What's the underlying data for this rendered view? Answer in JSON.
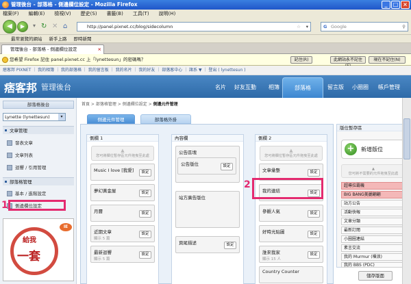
{
  "window": {
    "title": "管理後台 - 部落格 - 側邊欄位設定 - Mozilla Firefox"
  },
  "menu": [
    "檔案(F)",
    "編輯(E)",
    "檢視(V)",
    "歷史(S)",
    "書籤(B)",
    "工具(T)",
    "說明(H)"
  ],
  "nav": {
    "url": "http://panel.pixnet.cc/blog/sidecolumn",
    "search_placeholder": "Google"
  },
  "bookmarks": [
    "最常瀏覽的網站",
    "新手上路",
    "即時新聞"
  ],
  "tab": {
    "title": "管理後台 - 部落格 - 側邊欄位設定"
  },
  "notification": {
    "text": "您希望 Firefox 記住 panel.pixnet.cc 上「lynettesun」的密碼嗎？",
    "remember": "記住(R)",
    "never": "此網站永不記住(E)",
    "not_now": "現在不記住(N)"
  },
  "usernav": "痞客邦 PIXNET ｜ 我的相簿 ｜ 我的部落格 ｜ 我的留言板 ｜ 我的名片 ｜ 我的好友 ｜ 部落客中心 ｜ 諸系 ▼ ｜ 登出 ( lynettesun )",
  "header": {
    "logo": "痞客邦",
    "subtitle": "管理後台",
    "items": [
      "名片",
      "好友互動",
      "相簿",
      "部落格",
      "留言版",
      "小圈圈",
      "帳戶管理"
    ]
  },
  "sidebar": {
    "head": "部落格後台",
    "select": "Lynette (lynettesun)",
    "section1": "文章管理",
    "items1": [
      "發表文章",
      "文章列表",
      "迴響 / 引用管理"
    ],
    "section2": "部落格管理",
    "items2": [
      "基本 / 進階設定",
      "側邊欄位設定"
    ],
    "promo": {
      "line1": "給我",
      "line2": "一套",
      "badge": "IE"
    }
  },
  "annotations": {
    "label1": "1",
    "label2": "2"
  },
  "content": {
    "breadcrumb": [
      "首頁",
      "部落格管理",
      "側邊欄位設定"
    ],
    "breadcrumb_current": "側邊元件管理",
    "tabs": [
      "側邊元件管理",
      "部落格外掛"
    ],
    "col1": {
      "title": "側欄 1",
      "hint": "您可將欄位暫存區元件拖曳至此處",
      "modules": [
        {
          "title": "Music I love [我愛]",
          "sub": ""
        },
        {
          "title": "夢幻黃金屋",
          "sub": ""
        },
        {
          "title": "月曆",
          "sub": ""
        },
        {
          "title": "近期文章",
          "sub": "顯示 5 篇"
        },
        {
          "title": "最新迴響",
          "sub": "顯示 5 篇"
        }
      ]
    },
    "col2": {
      "title": "內容欄",
      "modules": [
        "公告區塊",
        "站方廣告版位",
        "頁尾描述"
      ],
      "inner": "公告版位"
    },
    "col3": {
      "title": "側欄 2",
      "hint": "您可將欄位暫存區元件拖曳至此處",
      "modules": [
        {
          "title": "文章彙整",
          "sub": ""
        },
        {
          "title": "我的連結",
          "sub": ""
        },
        {
          "title": "參觀人氣",
          "sub": ""
        },
        {
          "title": "好時光貼圖",
          "sub": ""
        },
        {
          "title": "誰來我家",
          "sub": "顯示 15 人"
        },
        {
          "title": "Country Counter",
          "sub": ""
        }
      ]
    },
    "set_label": "設定",
    "storage": {
      "title": "版位暫存區",
      "new_label": "新增版位",
      "hint": "您可將不需要的元件拖曳至此處",
      "items": [
        "超導拉霸機",
        "BIG BANG美麗翩翩",
        "站方公告",
        "活動快報",
        "文章分類",
        "最新訂閱",
        "小圈圈連結",
        "素言交流",
        "我的 Murmur (噗浪)",
        "我的 BBS (PDC)"
      ]
    },
    "save_label": "儲存版面"
  }
}
